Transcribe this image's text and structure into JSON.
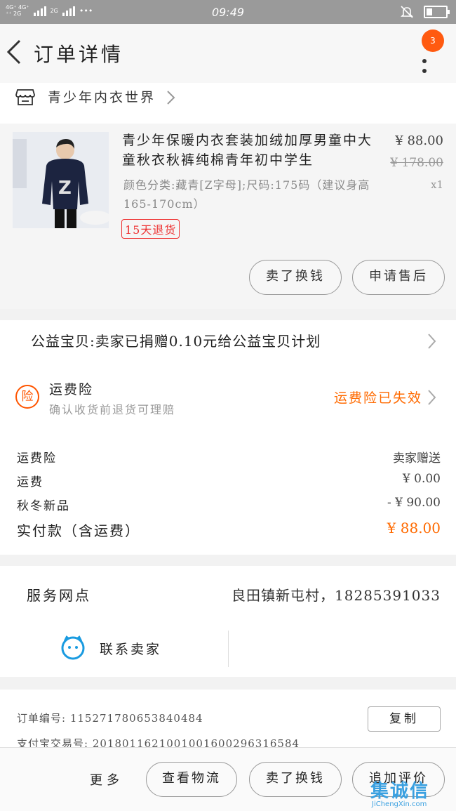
{
  "status_bar": {
    "network_label": "4G⁺ 4G⁺\n⁺⁺ 2G",
    "network2": "2G",
    "dots": "•••",
    "time": "09:49"
  },
  "header": {
    "title": "订单详情",
    "badge_count": "3"
  },
  "shop": {
    "name": "青少年内衣世界"
  },
  "product": {
    "title": "青少年保暖内衣套装加绒加厚男童中大童秋衣秋裤纯棉青年初中学生",
    "spec": "颜色分类:藏青[Z字母];尺码:175码（建议身高165-170cm）",
    "price": "¥ 88.00",
    "original_price": "¥ 178.00",
    "quantity": "x1",
    "return_tag": "15天退货",
    "btn_sold_again": "卖了换钱",
    "btn_after_sale": "申请售后"
  },
  "charity": {
    "text": "公益宝贝:卖家已捐赠0.10元给公益宝贝计划"
  },
  "insurance": {
    "icon_char": "险",
    "title": "运费险",
    "subtitle": "确认收货前退货可理赔",
    "status": "运费险已失效"
  },
  "cost": {
    "rows": [
      {
        "label": "运费险",
        "value": "卖家赠送"
      },
      {
        "label": "运费",
        "value": "¥ 0.00"
      },
      {
        "label": "秋冬新品",
        "value": "- ¥ 90.00"
      }
    ],
    "total_label": "实付款（含运费）",
    "total_value": "¥ 88.00"
  },
  "service": {
    "label": "服务网点",
    "value": "良田镇新屯村，18285391033",
    "contact": "联系卖家"
  },
  "order_info": {
    "order_no": "订单编号: 115271780653840484",
    "pay_no": "支付宝交易号: 2018011621001001600296316584",
    "copy": "复制"
  },
  "bottom_bar": {
    "more": "更多",
    "btn_logistics": "查看物流",
    "btn_sell": "卖了换钱",
    "btn_review": "追加评价"
  },
  "watermark": {
    "logo": "集诚信",
    "url": "JiChengXin.com"
  },
  "colors": {
    "accent": "#ff6a00",
    "badge": "#ff5a10",
    "chat_icon": "#1a9be0"
  }
}
